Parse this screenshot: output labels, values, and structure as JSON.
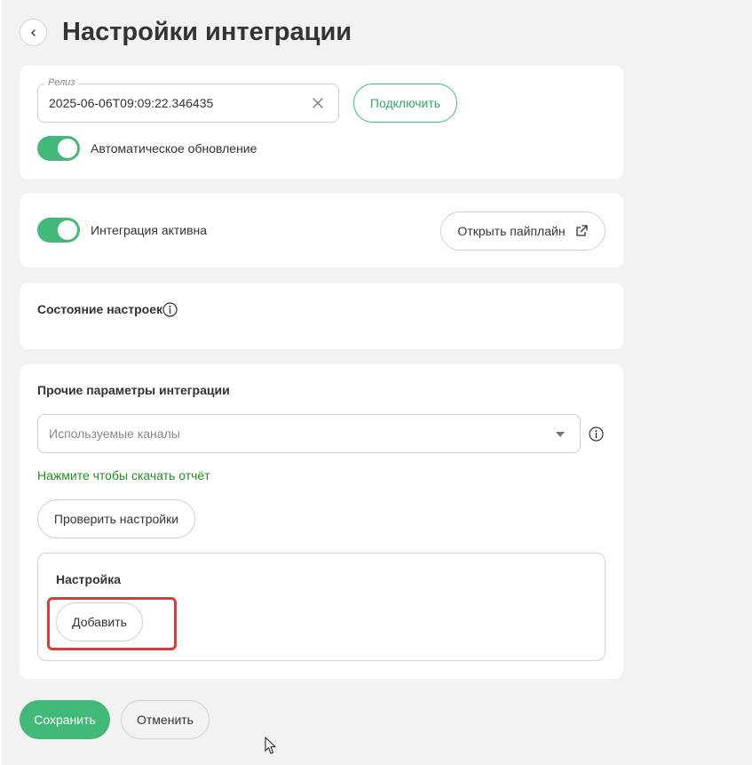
{
  "header": {
    "title": "Настройки интеграции",
    "back_icon": "chevron-left-icon"
  },
  "release": {
    "legend": "Релиз",
    "value": "2025-06-06T09:09:22.346435",
    "clear_icon": "close-icon",
    "connect_label": "Подключить",
    "auto_update_label": "Автоматическое обновление",
    "auto_update_on": true
  },
  "integration": {
    "active_label": "Интеграция активна",
    "active_on": true,
    "open_pipeline_label": "Открыть пайплайн",
    "open_pipeline_icon": "external-link-icon"
  },
  "settings_state": {
    "title": "Состояние настроек",
    "info_icon": "info-icon"
  },
  "other_params": {
    "title": "Прочие параметры интеграции",
    "channels_placeholder": "Используемые каналы",
    "dropdown_icon": "caret-down-icon",
    "info_icon": "info-icon",
    "report_link": "Нажмите чтобы скачать отчёт",
    "check_button": "Проверить настройки",
    "setup": {
      "title": "Настройка",
      "add_button": "Добавить"
    }
  },
  "footer": {
    "save_label": "Сохранить",
    "cancel_label": "Отменить"
  },
  "colors": {
    "accent": "#43b979",
    "link": "#1f8f1f",
    "highlight": "#d93a3a",
    "background": "#f2f2f2"
  }
}
